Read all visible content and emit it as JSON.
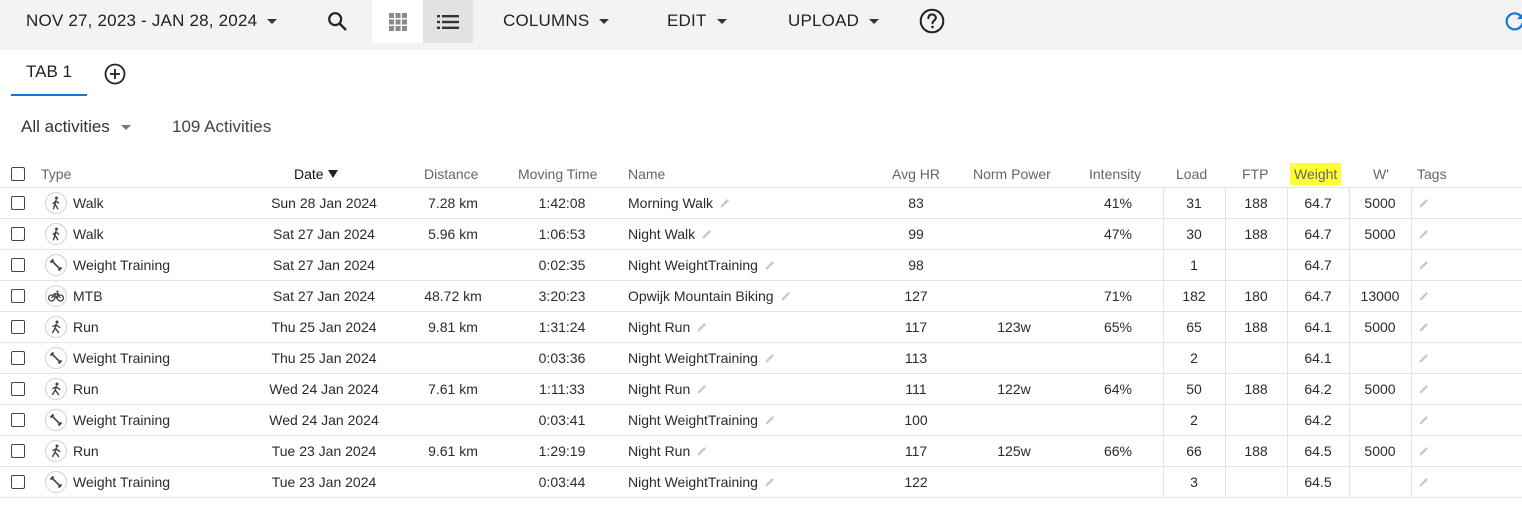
{
  "toolbar": {
    "date_range": "NOV 27, 2023 - JAN 28, 2024",
    "columns_label": "COLUMNS",
    "edit_label": "EDIT",
    "upload_label": "UPLOAD"
  },
  "tabs": [
    {
      "label": "TAB 1",
      "active": true
    }
  ],
  "filter": {
    "selected": "All activities",
    "count_text": "109 Activities"
  },
  "table": {
    "headers": {
      "type": "Type",
      "date": "Date",
      "distance": "Distance",
      "moving_time": "Moving Time",
      "name": "Name",
      "avg_hr": "Avg HR",
      "norm_power": "Norm Power",
      "intensity": "Intensity",
      "load": "Load",
      "ftp": "FTP",
      "weight": "Weight",
      "w_prime": "W'",
      "tags": "Tags"
    },
    "sort": {
      "column": "date",
      "direction": "desc"
    },
    "highlight_color": "#ffff33",
    "rows": [
      {
        "icon": "walk-icon",
        "type": "Walk",
        "date": "Sun 28 Jan 2024",
        "distance": "7.28 km",
        "moving_time": "1:42:08",
        "name": "Morning Walk",
        "avg_hr": "83",
        "norm_power": "",
        "intensity": "41%",
        "load": "31",
        "ftp": "188",
        "weight": "64.7",
        "w_prime": "5000"
      },
      {
        "icon": "walk-icon",
        "type": "Walk",
        "date": "Sat 27 Jan 2024",
        "distance": "5.96 km",
        "moving_time": "1:06:53",
        "name": "Night Walk",
        "avg_hr": "99",
        "norm_power": "",
        "intensity": "47%",
        "load": "30",
        "ftp": "188",
        "weight": "64.7",
        "w_prime": "5000"
      },
      {
        "icon": "weight-training-icon",
        "type": "Weight Training",
        "date": "Sat 27 Jan 2024",
        "distance": "",
        "moving_time": "0:02:35",
        "name": "Night WeightTraining",
        "avg_hr": "98",
        "norm_power": "",
        "intensity": "",
        "load": "1",
        "ftp": "",
        "weight": "64.7",
        "w_prime": ""
      },
      {
        "icon": "bike-icon",
        "type": "MTB",
        "date": "Sat 27 Jan 2024",
        "distance": "48.72 km",
        "moving_time": "3:20:23",
        "name": "Opwijk Mountain Biking",
        "avg_hr": "127",
        "norm_power": "",
        "intensity": "71%",
        "load": "182",
        "ftp": "180",
        "weight": "64.7",
        "w_prime": "13000"
      },
      {
        "icon": "run-icon",
        "type": "Run",
        "date": "Thu 25 Jan 2024",
        "distance": "9.81 km",
        "moving_time": "1:31:24",
        "name": "Night Run",
        "avg_hr": "117",
        "norm_power": "123w",
        "intensity": "65%",
        "load": "65",
        "ftp": "188",
        "weight": "64.1",
        "w_prime": "5000"
      },
      {
        "icon": "weight-training-icon",
        "type": "Weight Training",
        "date": "Thu 25 Jan 2024",
        "distance": "",
        "moving_time": "0:03:36",
        "name": "Night WeightTraining",
        "avg_hr": "113",
        "norm_power": "",
        "intensity": "",
        "load": "2",
        "ftp": "",
        "weight": "64.1",
        "w_prime": ""
      },
      {
        "icon": "run-icon",
        "type": "Run",
        "date": "Wed 24 Jan 2024",
        "distance": "7.61 km",
        "moving_time": "1:11:33",
        "name": "Night Run",
        "avg_hr": "111",
        "norm_power": "122w",
        "intensity": "64%",
        "load": "50",
        "ftp": "188",
        "weight": "64.2",
        "w_prime": "5000"
      },
      {
        "icon": "weight-training-icon",
        "type": "Weight Training",
        "date": "Wed 24 Jan 2024",
        "distance": "",
        "moving_time": "0:03:41",
        "name": "Night WeightTraining",
        "avg_hr": "100",
        "norm_power": "",
        "intensity": "",
        "load": "2",
        "ftp": "",
        "weight": "64.2",
        "w_prime": ""
      },
      {
        "icon": "run-icon",
        "type": "Run",
        "date": "Tue 23 Jan 2024",
        "distance": "9.61 km",
        "moving_time": "1:29:19",
        "name": "Night Run",
        "avg_hr": "117",
        "norm_power": "125w",
        "intensity": "66%",
        "load": "66",
        "ftp": "188",
        "weight": "64.5",
        "w_prime": "5000"
      },
      {
        "icon": "weight-training-icon",
        "type": "Weight Training",
        "date": "Tue 23 Jan 2024",
        "distance": "",
        "moving_time": "0:03:44",
        "name": "Night WeightTraining",
        "avg_hr": "122",
        "norm_power": "",
        "intensity": "",
        "load": "3",
        "ftp": "",
        "weight": "64.5",
        "w_prime": ""
      }
    ]
  }
}
